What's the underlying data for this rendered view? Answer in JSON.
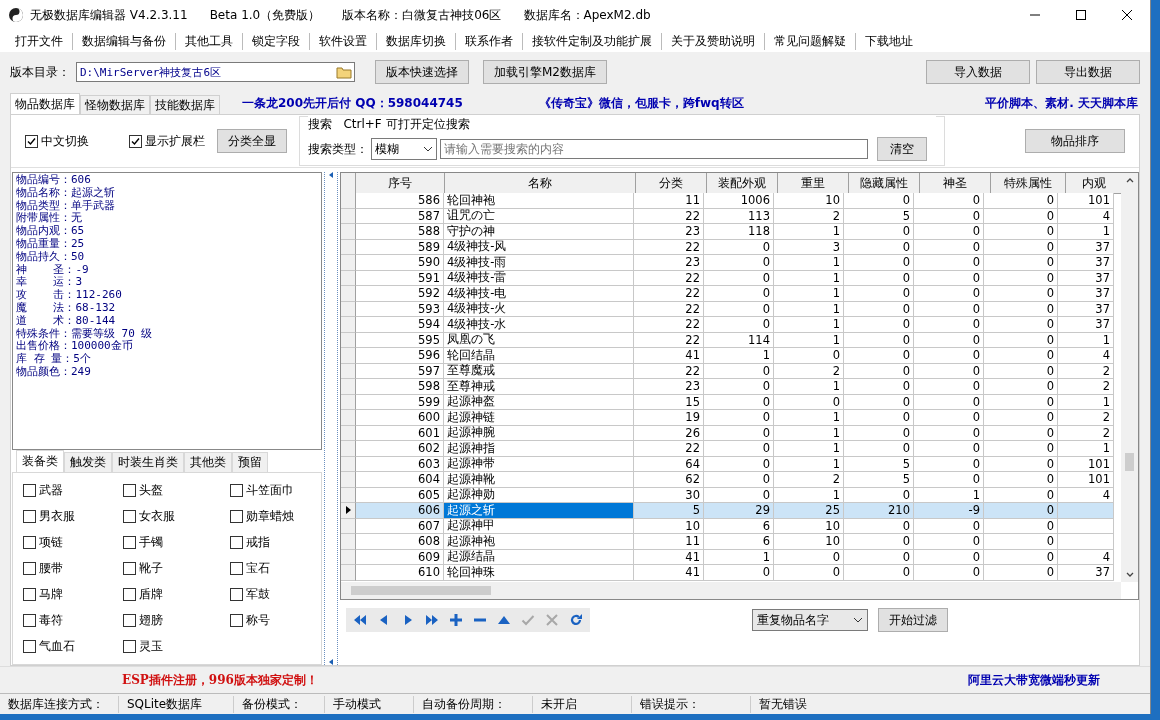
{
  "window": {
    "title": "无极数据库编辑器 V4.2.3.11",
    "edition": "Beta 1.0（免费版）",
    "version_name": "版本名称：白微复古神技06区",
    "db_name": "数据库名：ApexM2.db"
  },
  "menu": [
    "打开文件",
    "数据编辑与备份",
    "其他工具",
    "锁定字段",
    "软件设置",
    "数据库切换",
    "联系作者",
    "接软件定制及功能扩展",
    "关于及赞助说明",
    "常见问题解疑",
    "下载地址"
  ],
  "toolbar": {
    "dir_label": "版本目录：",
    "dir_value": "D:\\MirServer神技复古6区",
    "buttons": [
      "版本快速选择",
      "加载引擎M2数据库"
    ],
    "right_buttons": [
      "导入数据",
      "导出数据"
    ]
  },
  "tabs": [
    {
      "label": "物品数据库",
      "selected": true
    },
    {
      "label": "怪物数据库",
      "selected": false
    },
    {
      "label": "技能数据库",
      "selected": false
    }
  ],
  "banners": [
    "一条龙200先开后付 QQ：598044745",
    "《传奇宝》微信，包服卡，跨fwq转区",
    "平价脚本、素材. 天天脚本库"
  ],
  "options": [
    {
      "label": "中文切换",
      "checked": true
    },
    {
      "label": "显示扩展栏",
      "checked": true
    }
  ],
  "show_all_button": "分类全显",
  "search": {
    "legend": "搜索   Ctrl+F 可打开定位搜索",
    "type_label": "搜索类型：",
    "type_value": "模糊",
    "placeholder": "请输入需要搜索的内容",
    "clear_button": "清空"
  },
  "sort_button": "物品排序",
  "info_lines": [
    "物品编号：606",
    "物品名称：起源之斩",
    "物品类型：单手武器",
    "附带属性：无",
    "物品内观：65",
    "物品重量：25",
    "物品持久：50",
    "神    圣：-9",
    "幸    运：3",
    "攻    击：112-260",
    "魔    法：68-132",
    "道    术：80-144",
    "特殊条件：需要等级 70 级",
    "出售价格：100000金币",
    "库 存 量：5个",
    "物品颜色：249"
  ],
  "category_tabs": [
    {
      "label": "装备类",
      "selected": true
    },
    {
      "label": "触发类",
      "selected": false
    },
    {
      "label": "时装生肖类",
      "selected": false
    },
    {
      "label": "其他类",
      "selected": false
    },
    {
      "label": "预留",
      "selected": false
    }
  ],
  "categories": [
    {
      "label": "武器",
      "checked": false
    },
    {
      "label": "头盔",
      "checked": false
    },
    {
      "label": "斗笠面巾",
      "checked": false
    },
    {
      "label": "男衣服",
      "checked": false
    },
    {
      "label": "女衣服",
      "checked": false
    },
    {
      "label": "勋章蜡烛",
      "checked": false
    },
    {
      "label": "项链",
      "checked": false
    },
    {
      "label": "手镯",
      "checked": false
    },
    {
      "label": "戒指",
      "checked": false
    },
    {
      "label": "腰带",
      "checked": false
    },
    {
      "label": "靴子",
      "checked": false
    },
    {
      "label": "宝石",
      "checked": false
    },
    {
      "label": "马牌",
      "checked": false
    },
    {
      "label": "盾牌",
      "checked": false
    },
    {
      "label": "军鼓",
      "checked": false
    },
    {
      "label": "毒符",
      "checked": false
    },
    {
      "label": "翅膀",
      "checked": false
    },
    {
      "label": "称号",
      "checked": false
    },
    {
      "label": "气血石",
      "checked": false
    },
    {
      "label": "灵玉",
      "checked": false
    }
  ],
  "table": {
    "columns": [
      "序号",
      "名称",
      "分类",
      "装配外观",
      "重里",
      "隐藏属性",
      "神圣",
      "特殊属性",
      "内观"
    ],
    "rows": [
      {
        "selected": false,
        "cells": [
          "586",
          "轮回神袍",
          "11",
          "1006",
          "10",
          "0",
          "0",
          "0",
          "101"
        ]
      },
      {
        "selected": false,
        "cells": [
          "587",
          "诅咒の亡",
          "22",
          "113",
          "2",
          "5",
          "0",
          "0",
          "4"
        ]
      },
      {
        "selected": false,
        "cells": [
          "588",
          "守护の神",
          "23",
          "118",
          "1",
          "0",
          "0",
          "0",
          "1"
        ]
      },
      {
        "selected": false,
        "cells": [
          "589",
          "4级神技-风",
          "22",
          "0",
          "3",
          "0",
          "0",
          "0",
          "37"
        ]
      },
      {
        "selected": false,
        "cells": [
          "590",
          "4级神技-雨",
          "23",
          "0",
          "1",
          "0",
          "0",
          "0",
          "37"
        ]
      },
      {
        "selected": false,
        "cells": [
          "591",
          "4级神技-雷",
          "22",
          "0",
          "1",
          "0",
          "0",
          "0",
          "37"
        ]
      },
      {
        "selected": false,
        "cells": [
          "592",
          "4级神技-电",
          "22",
          "0",
          "1",
          "0",
          "0",
          "0",
          "37"
        ]
      },
      {
        "selected": false,
        "cells": [
          "593",
          "4级神技-火",
          "22",
          "0",
          "1",
          "0",
          "0",
          "0",
          "37"
        ]
      },
      {
        "selected": false,
        "cells": [
          "594",
          "4级神技-水",
          "22",
          "0",
          "1",
          "0",
          "0",
          "0",
          "37"
        ]
      },
      {
        "selected": false,
        "cells": [
          "595",
          "凤凰の飞",
          "22",
          "114",
          "1",
          "0",
          "0",
          "0",
          "1"
        ]
      },
      {
        "selected": false,
        "cells": [
          "596",
          "轮回结晶",
          "41",
          "1",
          "0",
          "0",
          "0",
          "0",
          "4"
        ]
      },
      {
        "selected": false,
        "cells": [
          "597",
          "至尊魔戒",
          "22",
          "0",
          "2",
          "0",
          "0",
          "0",
          "2"
        ]
      },
      {
        "selected": false,
        "cells": [
          "598",
          "至尊神戒",
          "23",
          "0",
          "1",
          "0",
          "0",
          "0",
          "2"
        ]
      },
      {
        "selected": false,
        "cells": [
          "599",
          "起源神盔",
          "15",
          "0",
          "0",
          "0",
          "0",
          "0",
          "1"
        ]
      },
      {
        "selected": false,
        "cells": [
          "600",
          "起源神链",
          "19",
          "0",
          "1",
          "0",
          "0",
          "0",
          "2"
        ]
      },
      {
        "selected": false,
        "cells": [
          "601",
          "起源神腕",
          "26",
          "0",
          "1",
          "0",
          "0",
          "0",
          "2"
        ]
      },
      {
        "selected": false,
        "cells": [
          "602",
          "起源神指",
          "22",
          "0",
          "1",
          "0",
          "0",
          "0",
          "1"
        ]
      },
      {
        "selected": false,
        "cells": [
          "603",
          "起源神带",
          "64",
          "0",
          "1",
          "5",
          "0",
          "0",
          "101"
        ]
      },
      {
        "selected": false,
        "cells": [
          "604",
          "起源神靴",
          "62",
          "0",
          "2",
          "5",
          "0",
          "0",
          "101"
        ]
      },
      {
        "selected": false,
        "cells": [
          "605",
          "起源神勋",
          "30",
          "0",
          "1",
          "0",
          "1",
          "0",
          "4"
        ]
      },
      {
        "selected": true,
        "cells": [
          "606",
          "起源之斩",
          "5",
          "29",
          "25",
          "210",
          "-9",
          "0",
          ""
        ]
      },
      {
        "selected": false,
        "cells": [
          "607",
          "起源神甲",
          "10",
          "6",
          "10",
          "0",
          "0",
          "0",
          ""
        ]
      },
      {
        "selected": false,
        "cells": [
          "608",
          "起源神袍",
          "11",
          "6",
          "10",
          "0",
          "0",
          "0",
          ""
        ]
      },
      {
        "selected": false,
        "cells": [
          "609",
          "起源结晶",
          "41",
          "1",
          "0",
          "0",
          "0",
          "0",
          "4"
        ]
      },
      {
        "selected": false,
        "cells": [
          "610",
          "轮回神珠",
          "41",
          "0",
          "0",
          "0",
          "0",
          "0",
          "37"
        ]
      }
    ]
  },
  "navigator": [
    {
      "kind": "first",
      "disabled": false
    },
    {
      "kind": "prior",
      "disabled": false
    },
    {
      "kind": "next",
      "disabled": false
    },
    {
      "kind": "last",
      "disabled": false
    },
    {
      "kind": "insert",
      "disabled": false
    },
    {
      "kind": "delete",
      "disabled": false
    },
    {
      "kind": "edit",
      "disabled": false
    },
    {
      "kind": "post",
      "disabled": true
    },
    {
      "kind": "cancel",
      "disabled": true
    },
    {
      "kind": "refresh",
      "disabled": false
    }
  ],
  "filter": {
    "value": "重复物品名字",
    "button": "开始过滤"
  },
  "ads": {
    "left": "ESP插件注册，996版本独家定制！",
    "right": "阿里云大带宽微端秒更新"
  },
  "status_bar": [
    "数据库连接方式：",
    "SQLite数据库",
    "备份模式：",
    "手动模式",
    "自动备份周期：",
    "未开启",
    "错误提示：",
    "暂无错误"
  ]
}
